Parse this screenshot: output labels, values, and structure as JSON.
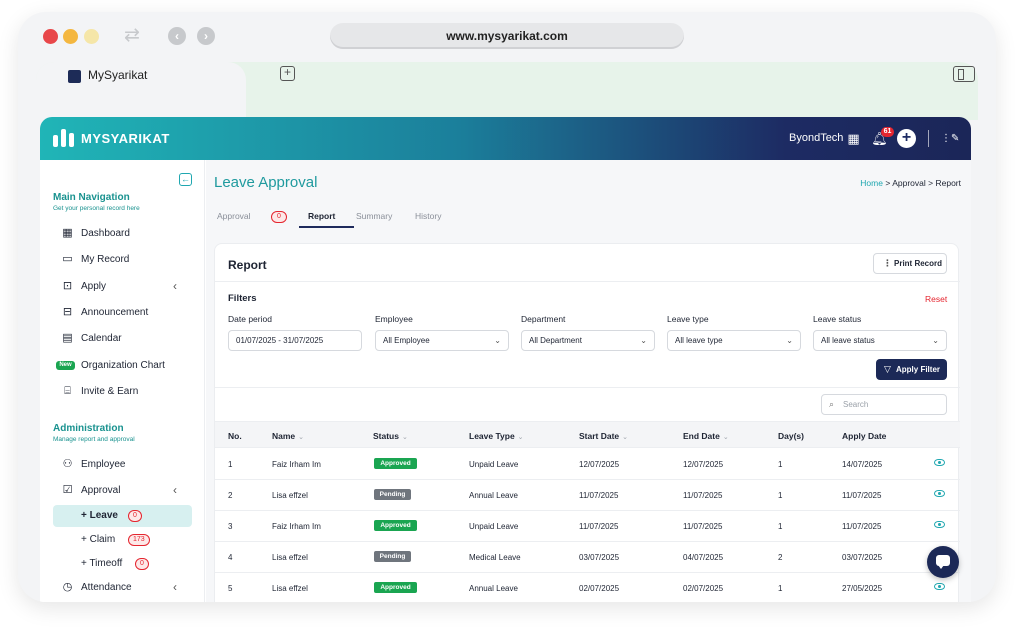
{
  "browser": {
    "url": "www.mysyarikat.com",
    "tab_title": "MySyarikat"
  },
  "topbar": {
    "brand": "MYSYARIKAT",
    "company": "ByondTech",
    "notification_count": "61"
  },
  "sidebar": {
    "main_title": "Main Navigation",
    "main_subtitle": "Get your personal record here",
    "main_items": [
      {
        "label": "Dashboard",
        "icon": "grid-icon"
      },
      {
        "label": "My Record",
        "icon": "folder-icon"
      },
      {
        "label": "Apply",
        "icon": "apply-icon"
      },
      {
        "label": "Announcement",
        "icon": "announcement-icon"
      },
      {
        "label": "Calendar",
        "icon": "calendar-icon"
      },
      {
        "label": "Organization Chart",
        "badge": "New"
      },
      {
        "label": "Invite & Earn",
        "icon": "gift-icon"
      }
    ],
    "admin_title": "Administration",
    "admin_subtitle": "Manage report and approval",
    "admin_items": [
      {
        "label": "Employee",
        "icon": "users-icon"
      },
      {
        "label": "Approval",
        "icon": "check-square-icon"
      }
    ],
    "approval_sub": [
      {
        "label": "+  Leave",
        "count": "0"
      },
      {
        "label": "+  Claim",
        "count": "173"
      },
      {
        "label": "+  Timeoff",
        "count": "0"
      }
    ],
    "cut_item": "Attendance"
  },
  "main": {
    "title": "Leave Approval",
    "breadcrumb": {
      "home": "Home",
      "approval": "Approval",
      "current": "Report",
      "sep": ">"
    },
    "tabs": [
      {
        "label": "Approval",
        "badge": "0"
      },
      {
        "label": "Report"
      },
      {
        "label": "Summary"
      },
      {
        "label": "History"
      }
    ],
    "card_title": "Report",
    "print_label": "Print Record",
    "filters_label": "Filters",
    "reset_label": "Reset",
    "filters": [
      {
        "label": "Date period",
        "value": "01/07/2025 - 31/07/2025"
      },
      {
        "label": "Employee",
        "value": "All Employee"
      },
      {
        "label": "Department",
        "value": "All Department"
      },
      {
        "label": "Leave type",
        "value": "All leave type"
      },
      {
        "label": "Leave status",
        "value": "All leave status"
      }
    ],
    "apply_filter_label": "Apply Filter",
    "search_placeholder": "Search",
    "columns": [
      "No.",
      "Name",
      "Status",
      "Leave Type",
      "Start Date",
      "End Date",
      "Day(s)",
      "Apply Date"
    ],
    "rows": [
      {
        "no": "1",
        "name": "Faiz Irham Im",
        "status": "Approved",
        "type": "Unpaid Leave",
        "start": "12/07/2025",
        "end": "12/07/2025",
        "days": "1",
        "applied": "14/07/2025"
      },
      {
        "no": "2",
        "name": "Lisa effzel",
        "status": "Pending",
        "type": "Annual Leave",
        "start": "11/07/2025",
        "end": "11/07/2025",
        "days": "1",
        "applied": "11/07/2025"
      },
      {
        "no": "3",
        "name": "Faiz Irham Im",
        "status": "Approved",
        "type": "Unpaid Leave",
        "start": "11/07/2025",
        "end": "11/07/2025",
        "days": "1",
        "applied": "11/07/2025"
      },
      {
        "no": "4",
        "name": "Lisa effzel",
        "status": "Pending",
        "type": "Medical Leave",
        "start": "03/07/2025",
        "end": "04/07/2025",
        "days": "2",
        "applied": "03/07/2025"
      },
      {
        "no": "5",
        "name": "Lisa effzel",
        "status": "Approved",
        "type": "Annual Leave",
        "start": "02/07/2025",
        "end": "02/07/2025",
        "days": "1",
        "applied": "27/05/2025"
      }
    ]
  },
  "colors": {
    "accent": "#1fa7b0",
    "navy": "#1c2957",
    "approved": "#1aa551",
    "pending": "#6f757d",
    "alert": "#e5252f"
  }
}
